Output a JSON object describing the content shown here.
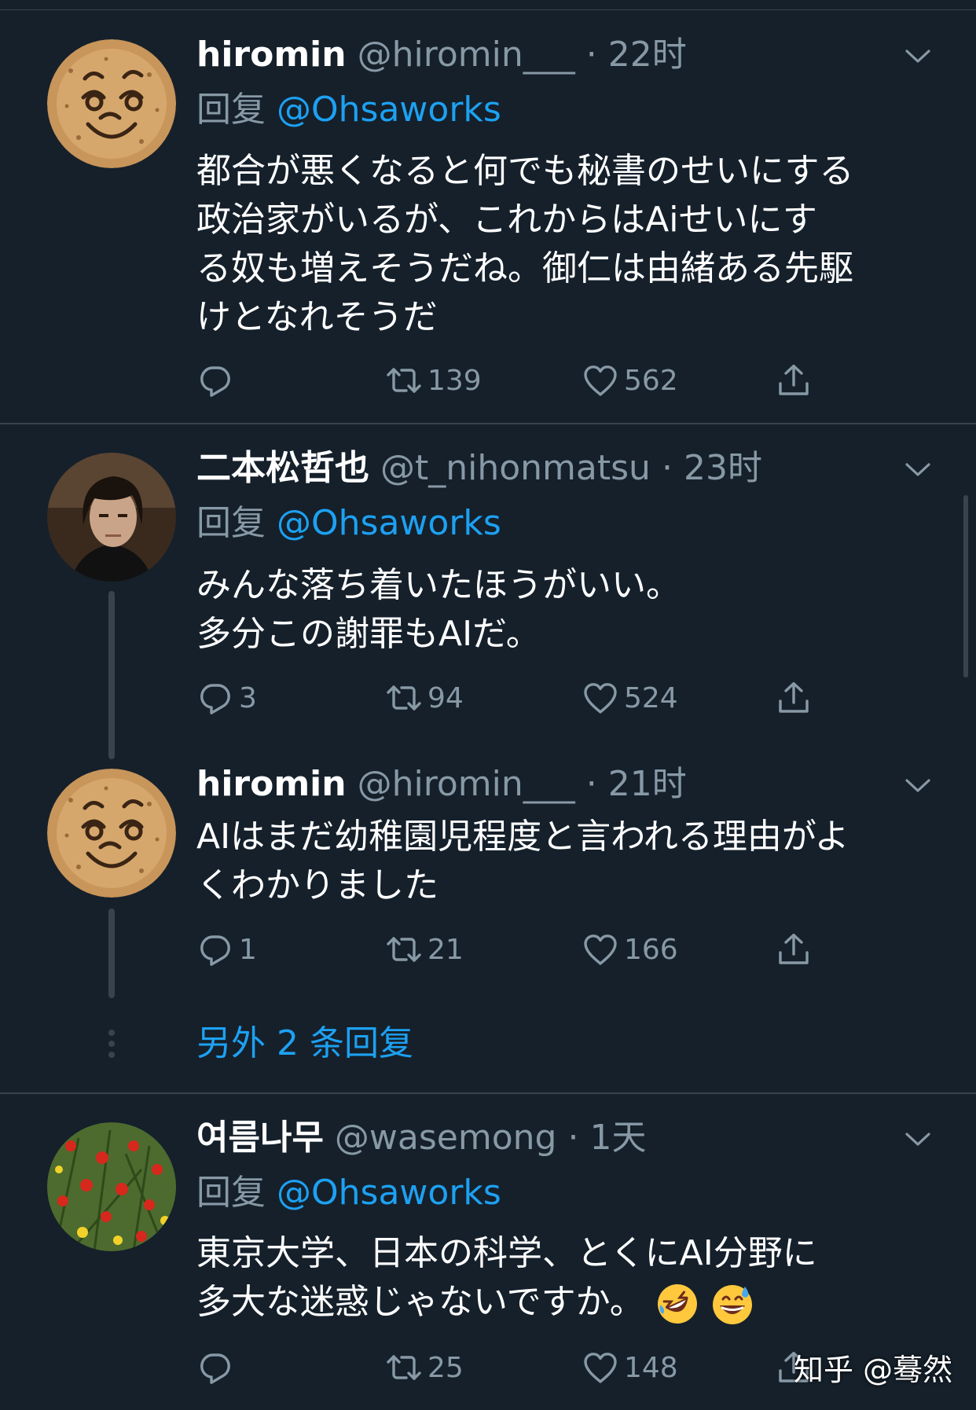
{
  "tweets": [
    {
      "name": "hiromin",
      "handle": "@hiromin___",
      "dot": "·",
      "time": "22时",
      "reply_prefix": "回复",
      "reply_to": "@Ohsaworks",
      "lines": [
        "都合が悪くなると何でも秘書のせいにする",
        "政治家がいるが、これからはAiせいにす",
        "る奴も増えそうだね。御仁は由緒ある先駆",
        "けとなれそうだ"
      ],
      "replies": "",
      "retweets": "139",
      "likes": "562",
      "avatar": "cookie-face"
    },
    {
      "name": "二本松哲也",
      "handle": "@t_nihonmatsu",
      "dot": "·",
      "time": "23时",
      "reply_prefix": "回复",
      "reply_to": "@Ohsaworks",
      "lines": [
        "みんな落ち着いたほうがいい。",
        "多分この謝罪もAIだ。"
      ],
      "replies": "3",
      "retweets": "94",
      "likes": "524",
      "avatar": "man-portrait"
    },
    {
      "name": "hiromin",
      "handle": "@hiromin___",
      "dot": "·",
      "time": "21时",
      "lines": [
        "AIはまだ幼稚園児程度と言われる理由がよ",
        "くわかりました"
      ],
      "replies": "1",
      "retweets": "21",
      "likes": "166",
      "avatar": "cookie-face"
    },
    {
      "name": "여름나무",
      "handle": "@wasemong",
      "dot": "·",
      "time": "1天",
      "reply_prefix": "回复",
      "reply_to": "@Ohsaworks",
      "lines": [
        "東京大学、日本の科学、とくにAI分野に",
        "多大な迷惑じゃないですか。"
      ],
      "emojis": [
        "rolling-on-floor-laughing",
        "grinning-sweat"
      ],
      "replies": "",
      "retweets": "25",
      "likes": "148",
      "avatar": "tulip-flowers"
    }
  ],
  "more_replies": "另外 2 条回复",
  "watermark": "知乎 @蓦然",
  "colors": {
    "background": "#15202b",
    "divider": "#38444d",
    "secondary_text": "#8899a6",
    "link": "#1da1f2"
  },
  "icons": [
    "reply-icon",
    "retweet-icon",
    "like-icon",
    "share-icon",
    "chevron-down-icon"
  ]
}
